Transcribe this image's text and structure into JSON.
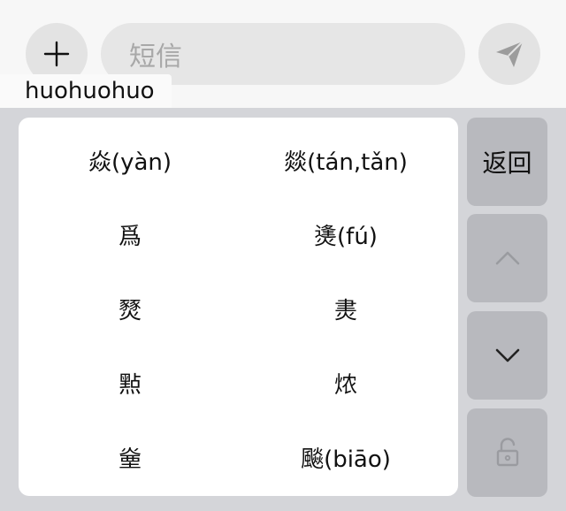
{
  "composer": {
    "add_icon": "plus-icon",
    "input_placeholder": "短信",
    "send_icon": "send-icon",
    "pinyin": "huohuohuo"
  },
  "keyboard": {
    "candidates": [
      {
        "label": "焱(yàn)"
      },
      {
        "label": "燚(tán,tǎn)"
      },
      {
        "label": "爲"
      },
      {
        "label": "㷭(fú)"
      },
      {
        "label": "燹"
      },
      {
        "label": "㶳"
      },
      {
        "label": "㸃"
      },
      {
        "label": "㶶"
      },
      {
        "label": "㷑"
      },
      {
        "label": "飈(biāo)"
      }
    ],
    "back_label": "返回",
    "up_icon": "chevron-up-icon",
    "down_icon": "chevron-down-icon",
    "lock_icon": "unlock-icon"
  },
  "colors": {
    "background": "#f7f7f7",
    "keyboard_bg": "#d4d5d9",
    "key_bg": "#b8b9be",
    "candidate_bg": "#ffffff"
  }
}
